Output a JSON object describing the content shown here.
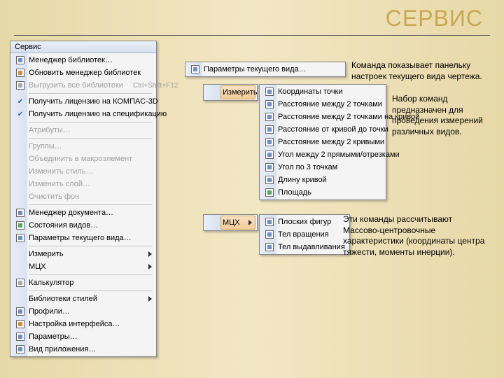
{
  "title": "СЕРВИС",
  "mainMenu": {
    "header": "Сервис",
    "items": [
      {
        "label": "Менеджер библиотек…",
        "icon": "box"
      },
      {
        "label": "Обновить менеджер библиотек",
        "icon": "refresh"
      },
      {
        "label": "Выгрузить все библиотеки",
        "shortcut": "Ctrl+Shift+F12",
        "disabled": true,
        "icon": "unload"
      },
      {
        "sep": true
      },
      {
        "label": "Получить лицензию на КОМПАС-3D",
        "checked": true
      },
      {
        "label": "Получить лицензию на спецификацию",
        "checked": true
      },
      {
        "sep": true
      },
      {
        "label": "Атрибуты…",
        "disabled": true
      },
      {
        "sep": true
      },
      {
        "label": "Группы…",
        "disabled": true
      },
      {
        "label": "Объединить в макроэлемент",
        "disabled": true
      },
      {
        "label": "Изменить стиль…",
        "disabled": true
      },
      {
        "label": "Изменить слой…",
        "disabled": true
      },
      {
        "label": "Очистить фон",
        "disabled": true
      },
      {
        "sep": true
      },
      {
        "label": "Менеджер документа…",
        "icon": "doc"
      },
      {
        "label": "Состояния видов…",
        "icon": "views"
      },
      {
        "label": "Параметры текущего вида…",
        "icon": "params"
      },
      {
        "sep": true
      },
      {
        "label": "Измерить",
        "submenu": true
      },
      {
        "label": "МЦХ",
        "submenu": true
      },
      {
        "sep": true
      },
      {
        "label": "Калькулятор",
        "icon": "calc"
      },
      {
        "sep": true
      },
      {
        "label": "Библиотеки стилей",
        "submenu": true
      },
      {
        "label": "Профили…",
        "icon": "profile"
      },
      {
        "label": "Настройка интерфейса…",
        "icon": "gear"
      },
      {
        "label": "Параметры…",
        "icon": "params2"
      },
      {
        "label": "Вид приложения…",
        "icon": "appview"
      }
    ]
  },
  "paramBtn": {
    "label": "Параметры текущего вида…",
    "icon": "params"
  },
  "measureHeader": "Измерить",
  "measureItems": [
    {
      "label": "Координаты точки",
      "icon": "pt"
    },
    {
      "label": "Расстояние между 2 точками",
      "icon": "m1"
    },
    {
      "label": "Расстояние между 2 точками на кривой",
      "icon": "m2"
    },
    {
      "label": "Расстояние от кривой до точки",
      "icon": "m3"
    },
    {
      "label": "Расстояние между 2 кривыми",
      "icon": "m4"
    },
    {
      "label": "Угол между 2 прямыми/отрезками",
      "icon": "ang"
    },
    {
      "label": "Угол по 3 точкам",
      "icon": "ang3"
    },
    {
      "label": "Длину кривой",
      "icon": "len"
    },
    {
      "label": "Площадь",
      "icon": "area"
    }
  ],
  "mcxHeader": "МЦХ",
  "mcxItems": [
    {
      "label": "Плоских фигур",
      "icon": "flat"
    },
    {
      "label": "Тел вращения",
      "icon": "rev"
    },
    {
      "label": "Тел выдавливания",
      "icon": "ext"
    }
  ],
  "captions": {
    "c1": "Команда показывает панельку настроек текущего вида чертежа.",
    "c2": "Набор команд предназначен для проведения измерений различных видов.",
    "c3": "Эти команды рассчитывают Массово-центровочные характеристики (координаты центра тяжести, моменты инерции)."
  }
}
